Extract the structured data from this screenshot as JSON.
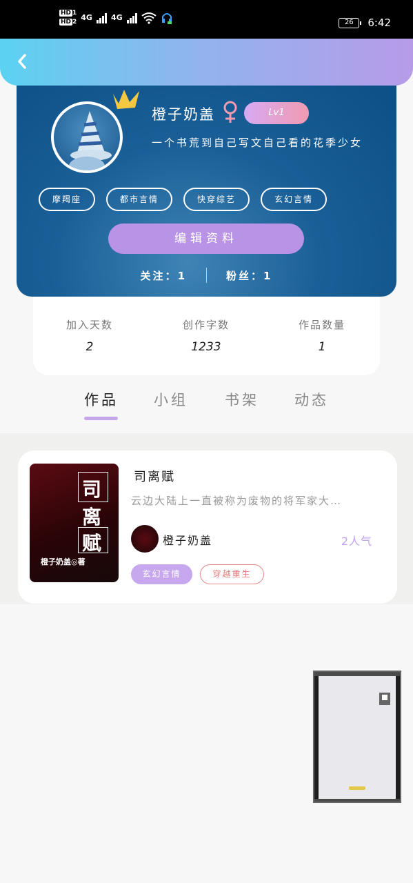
{
  "status_bar": {
    "hd1": "HD",
    "hd1_sub": "1",
    "hd2": "HD",
    "hd2_sub": "2",
    "net1": "4G",
    "net2": "4G",
    "battery": "26",
    "time": "6:42"
  },
  "profile": {
    "username": "橙子奶盖",
    "gender_symbol": "♀",
    "level": "Lv1",
    "bio": "一个书荒到自己写文自己看的花季少女",
    "tags": [
      "摩羯座",
      "都市言情",
      "快穿综艺",
      "玄幻言情"
    ],
    "edit_button": "编辑资料",
    "following_label": "关注：",
    "following_value": "1",
    "followers_label": "粉丝：",
    "followers_value": "1"
  },
  "stats": [
    {
      "label": "加入天数",
      "value": "2"
    },
    {
      "label": "创作字数",
      "value": "1233"
    },
    {
      "label": "作品数量",
      "value": "1"
    }
  ],
  "tabs": [
    "作品",
    "小组",
    "书架",
    "动态"
  ],
  "active_tab": "作品",
  "work": {
    "title": "司离赋",
    "description": "云边大陆上一直被称为废物的将军家大…",
    "cover_chars": [
      "司",
      "离",
      "赋"
    ],
    "cover_author": "橙子奶盖◎著",
    "author_name": "橙子奶盖",
    "popularity": "2人气",
    "tags": [
      "玄幻言情",
      "穿越重生"
    ]
  },
  "colors": {
    "header_gradient_start": "#5bd2f1",
    "header_gradient_end": "#b79be9",
    "profile_bg": "#0c4e86",
    "accent_purple": "#b993e6",
    "tag_red": "#e07a7a"
  }
}
